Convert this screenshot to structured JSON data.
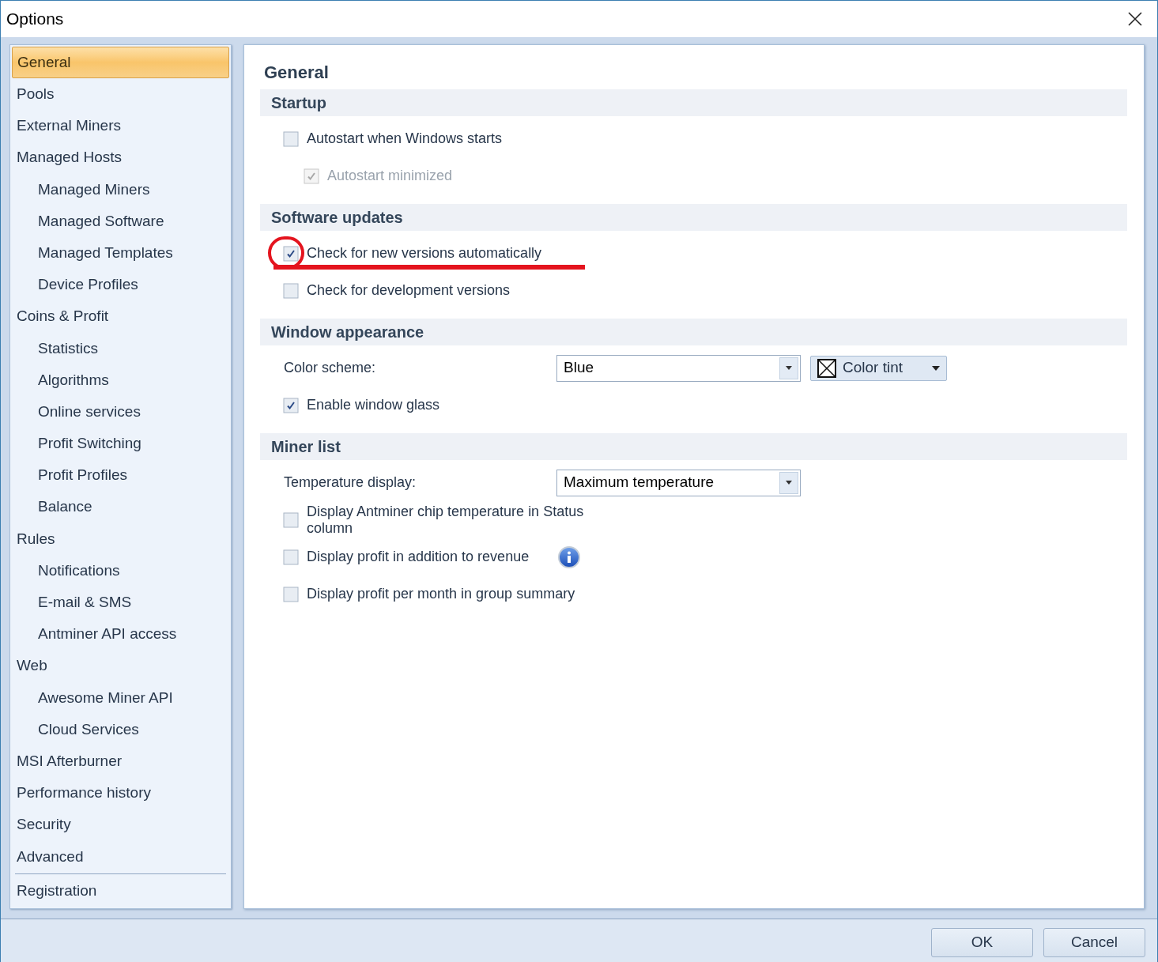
{
  "window": {
    "title": "Options"
  },
  "sidebar": {
    "items": [
      {
        "label": "General",
        "selected": true
      },
      {
        "label": "Pools",
        "selected": false
      },
      {
        "label": "External Miners",
        "selected": false
      },
      {
        "label": "Managed Hosts",
        "selected": false,
        "children": [
          {
            "label": "Managed Miners",
            "selected": false
          },
          {
            "label": "Managed Software",
            "selected": false
          },
          {
            "label": "Managed Templates",
            "selected": false
          },
          {
            "label": "Device Profiles",
            "selected": false
          }
        ]
      },
      {
        "label": "Coins & Profit",
        "selected": false,
        "children": [
          {
            "label": "Statistics",
            "selected": false
          },
          {
            "label": "Algorithms",
            "selected": false
          },
          {
            "label": "Online services",
            "selected": false
          },
          {
            "label": "Profit Switching",
            "selected": false
          },
          {
            "label": "Profit Profiles",
            "selected": false
          },
          {
            "label": "Balance",
            "selected": false
          }
        ]
      },
      {
        "label": "Rules",
        "selected": false,
        "children": [
          {
            "label": "Notifications",
            "selected": false
          },
          {
            "label": "E-mail & SMS",
            "selected": false
          },
          {
            "label": "Antminer API access",
            "selected": false
          }
        ]
      },
      {
        "label": "Web",
        "selected": false,
        "children": [
          {
            "label": "Awesome Miner API",
            "selected": false
          },
          {
            "label": "Cloud Services",
            "selected": false
          }
        ]
      },
      {
        "label": "MSI Afterburner",
        "selected": false
      },
      {
        "label": "Performance history",
        "selected": false
      },
      {
        "label": "Security",
        "selected": false
      },
      {
        "label": "Advanced",
        "selected": false
      },
      {
        "label": "Registration",
        "selected": false,
        "separator_before": true
      }
    ]
  },
  "panel": {
    "title": "General",
    "sections": [
      {
        "title": "Startup",
        "options": [
          {
            "kind": "checkbox",
            "label": "Autostart when Windows starts",
            "checked": false,
            "disabled": false,
            "annotated": false,
            "info": false,
            "children": [
              {
                "kind": "checkbox",
                "label": "Autostart minimized",
                "checked": true,
                "disabled": true,
                "annotated": false,
                "info": false
              }
            ]
          }
        ]
      },
      {
        "title": "Software updates",
        "options": [
          {
            "kind": "checkbox",
            "label": "Check for new versions automatically",
            "checked": true,
            "disabled": false,
            "annotated": true,
            "info": false
          },
          {
            "kind": "checkbox",
            "label": "Check for development versions",
            "checked": false,
            "disabled": false,
            "annotated": false,
            "info": false
          }
        ]
      },
      {
        "title": "Window appearance",
        "options": [
          {
            "kind": "select",
            "label": "Color scheme:",
            "value": "Blue",
            "tint_button": {
              "label": "Color tint"
            }
          },
          {
            "kind": "checkbox",
            "label": "Enable window glass",
            "checked": true,
            "disabled": false,
            "annotated": false,
            "info": false
          }
        ]
      },
      {
        "title": "Miner list",
        "options": [
          {
            "kind": "select",
            "label": "Temperature display:",
            "value": "Maximum temperature"
          },
          {
            "kind": "checkbox",
            "label": "Display Antminer chip temperature in Status column",
            "checked": false,
            "disabled": false,
            "annotated": false,
            "info": false
          },
          {
            "kind": "checkbox",
            "label": "Display profit in addition to revenue",
            "checked": false,
            "disabled": false,
            "annotated": false,
            "info": true
          },
          {
            "kind": "checkbox",
            "label": "Display profit per month in group summary",
            "checked": false,
            "disabled": false,
            "annotated": false,
            "info": false
          }
        ]
      }
    ]
  },
  "buttons": [
    {
      "label": "OK"
    },
    {
      "label": "Cancel"
    }
  ]
}
